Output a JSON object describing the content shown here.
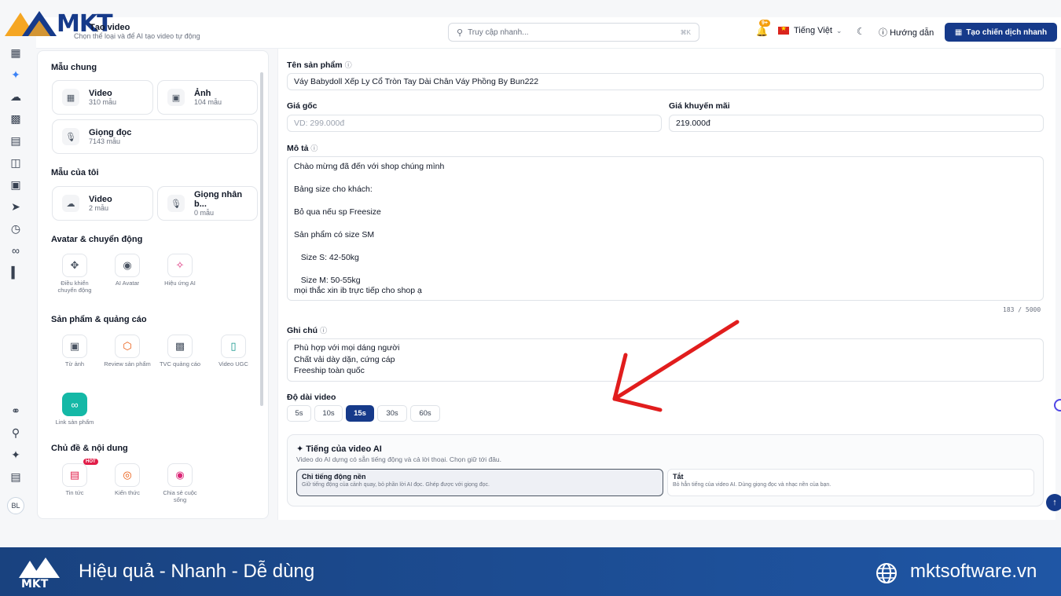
{
  "brand": {
    "logo_text": "MKT"
  },
  "header": {
    "title": "Tạo video",
    "subtitle": "Chọn thể loại và để AI tạo video tự động",
    "search_placeholder": "Truy cập nhanh...",
    "search_shortcut": "⌘K",
    "notification_badge": "9+",
    "language": "Tiếng Việt",
    "guide": "Hướng dẫn",
    "cta": "Tạo chiến dịch nhanh"
  },
  "panel": {
    "general": {
      "title": "Mẫu chung",
      "cards": [
        {
          "title": "Video",
          "sub": "310 mẫu"
        },
        {
          "title": "Ảnh",
          "sub": "104 mẫu"
        },
        {
          "title": "Giọng đọc",
          "sub": "7143 mẫu"
        }
      ]
    },
    "mine": {
      "title": "Mẫu của tôi",
      "cards": [
        {
          "title": "Video",
          "sub": "2 mẫu"
        },
        {
          "title": "Giọng nhân b...",
          "sub": "0 mẫu"
        }
      ]
    },
    "avatar": {
      "title": "Avatar & chuyển động",
      "tools": [
        "Điều khiển chuyển động",
        "AI Avatar",
        "Hiệu ứng AI"
      ]
    },
    "product": {
      "title": "Sản phẩm & quảng cáo",
      "tools": [
        "Từ ảnh",
        "Review sản phẩm",
        "TVC quảng cáo",
        "Video UGC",
        "Link sản phẩm"
      ]
    },
    "topic": {
      "title": "Chủ đề & nội dung",
      "hot": "HOT",
      "tools": [
        "Tin tức",
        "Kiến thức",
        "Chia sẻ cuộc sống"
      ]
    }
  },
  "form": {
    "product_name_label": "Tên sản phẩm",
    "product_name": "Váy Babydoll Xếp Ly Cổ Tròn Tay Dài Chân Váy Phồng By Bun222",
    "price_label": "Giá gốc",
    "price_placeholder": "VD: 299.000đ",
    "sale_label": "Giá khuyến mãi",
    "sale_value": "219.000đ",
    "desc_label": "Mô tả",
    "desc_lines": [
      "Chào mừng đã đến với shop chúng mình",
      "",
      "Bảng size cho khách:",
      "",
      "Bỏ qua nếu sp Freesize",
      "",
      "Sản phẩm có size SM",
      "",
      "   Size S: 42-50kg",
      "",
      "   Size M: 50-55kg",
      "mọi thắc xin ib trực tiếp cho shop ạ"
    ],
    "desc_counter": "183 / 5000",
    "note_label": "Ghi chú",
    "note_lines": [
      "Phù hợp với mọi dáng người",
      "Chất vải dày dặn, cứng cáp",
      "Freeship toàn quốc"
    ],
    "duration_label": "Độ dài video",
    "durations": [
      "5s",
      "10s",
      "15s",
      "30s",
      "60s"
    ],
    "duration_selected": "15s",
    "ai_sound_title": "Tiếng của video AI",
    "ai_sound_sub": "Video do AI dựng có sẵn tiếng động và cả lời thoại. Chọn giữ tới đâu.",
    "options": [
      {
        "title": "Chỉ tiếng động nền",
        "sub": "Giữ tiếng động của cảnh quay, bỏ phần lời AI đọc. Ghép được với giọng đọc."
      },
      {
        "title": "Tắt",
        "sub": "Bỏ hẳn tiếng của video AI. Dùng giọng đọc và nhạc nền của bạn."
      }
    ]
  },
  "user": {
    "initials": "BL"
  },
  "footer": {
    "logo_text": "MKT",
    "slogan": "Hiệu quả - Nhanh - Dễ dùng",
    "site": "mktsoftware.vn"
  },
  "colors": {
    "primary": "#163a8a",
    "accent": "#3b82f6",
    "arrow": "#e11d1d",
    "logo_orange": "#f5a623"
  }
}
